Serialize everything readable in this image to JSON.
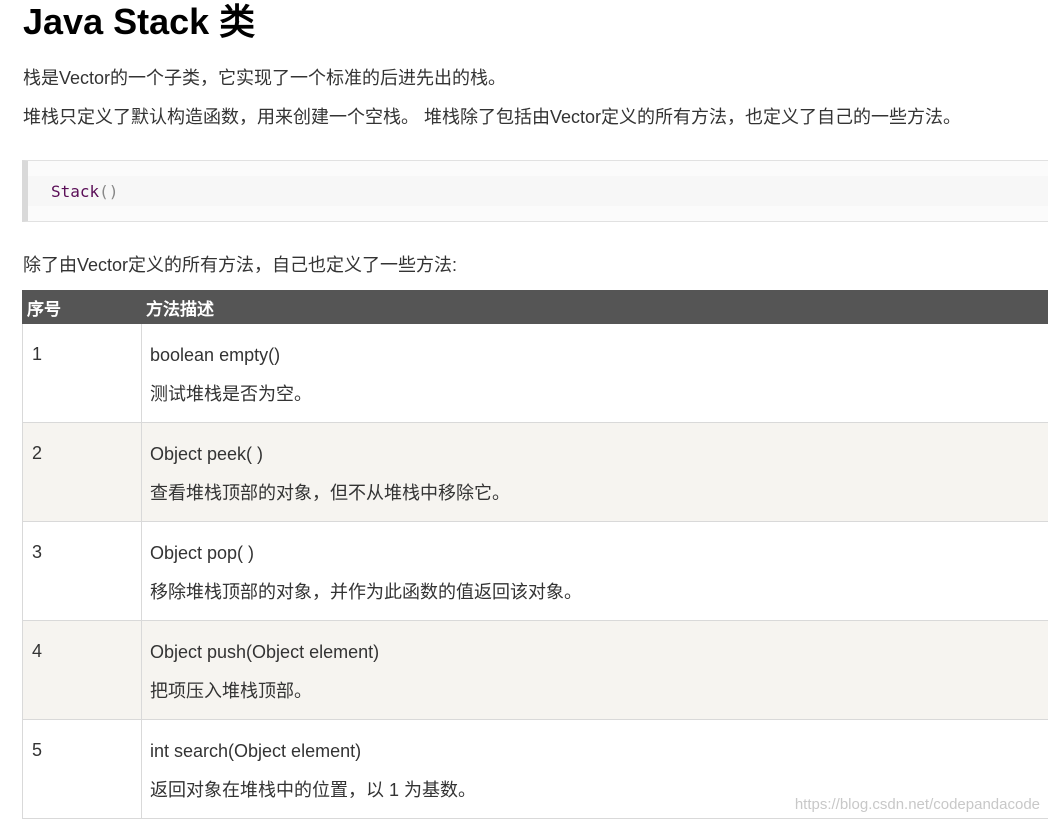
{
  "article": {
    "title": "Java Stack 类",
    "intro_1": "栈是Vector的一个子类，它实现了一个标准的后进先出的栈。",
    "intro_2": "堆栈只定义了默认构造函数，用来创建一个空栈。 堆栈除了包括由Vector定义的所有方法，也定义了自己的一些方法。",
    "code": {
      "identifier": "Stack",
      "parens": "()"
    },
    "methods_intro": "除了由Vector定义的所有方法，自己也定义了一些方法:"
  },
  "table": {
    "headers": {
      "number": "序号",
      "description": "方法描述"
    },
    "rows": [
      {
        "number": "1",
        "signature": "boolean empty()",
        "note": "测试堆栈是否为空。"
      },
      {
        "number": "2",
        "signature": "Object peek( )",
        "note": "查看堆栈顶部的对象，但不从堆栈中移除它。"
      },
      {
        "number": "3",
        "signature": "Object pop( )",
        "note": "移除堆栈顶部的对象，并作为此函数的值返回该对象。"
      },
      {
        "number": "4",
        "signature": "Object push(Object element)",
        "note": "把项压入堆栈顶部。"
      },
      {
        "number": "5",
        "signature": "int search(Object element)",
        "note": "返回对象在堆栈中的位置，以 1 为基数。"
      }
    ]
  },
  "watermark": "https://blog.csdn.net/codepandacode",
  "colors": {
    "header_bg": "#555555",
    "row_alt_bg": "#f6f4f0",
    "code_ident": "#5a0e57"
  }
}
